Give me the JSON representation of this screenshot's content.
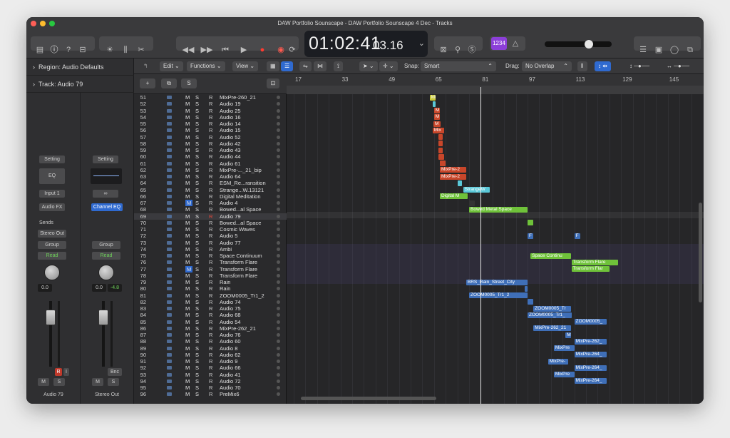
{
  "window": {
    "title": "DAW Portfolio Sounscape - DAW Portfolio Sounscape 4 Dec - Tracks"
  },
  "transport": {
    "time_main": "01:02:41",
    "time_sub": "03.16",
    "count_in": "1234"
  },
  "inspector": {
    "region_label": "Region: Audio Defaults",
    "track_label": "Track: Audio 79",
    "strip1": {
      "setting": "Setting",
      "eq": "EQ",
      "input": "Input 1",
      "fx": "Audio FX",
      "sends": "Sends",
      "output": "Stereo Out",
      "group": "Group",
      "mode": "Read",
      "pan": "0.0",
      "m": "M",
      "s": "S",
      "name": "Audio 79"
    },
    "strip2": {
      "setting": "Setting",
      "link": "∞",
      "eq": "Channel EQ",
      "group": "Group",
      "mode": "Read",
      "pan": "0.0",
      "gain": "-4.8",
      "bnc": "Bnc",
      "m": "M",
      "s": "S",
      "name": "Stereo Out"
    }
  },
  "editbar": {
    "edit": "Edit",
    "functions": "Functions",
    "view": "View",
    "snap_label": "Snap:",
    "snap_value": "Smart",
    "drag_label": "Drag:",
    "drag_value": "No Overlap"
  },
  "ruler": [
    "17",
    "33",
    "49",
    "65",
    "81",
    "97",
    "113",
    "129",
    "145"
  ],
  "tracks": [
    {
      "n": "51",
      "name": "MixPre-260_21"
    },
    {
      "n": "52",
      "name": "Audio 19"
    },
    {
      "n": "53",
      "name": "Audio 25"
    },
    {
      "n": "54",
      "name": "Audio 16"
    },
    {
      "n": "55",
      "name": "Audio 14"
    },
    {
      "n": "56",
      "name": "Audio 15"
    },
    {
      "n": "57",
      "name": "Audio 52"
    },
    {
      "n": "58",
      "name": "Audio 42"
    },
    {
      "n": "59",
      "name": "Audio 43"
    },
    {
      "n": "60",
      "name": "Audio 44"
    },
    {
      "n": "61",
      "name": "Audio 61"
    },
    {
      "n": "62",
      "name": "MixPre-..._21_bip"
    },
    {
      "n": "63",
      "name": "Audio 64"
    },
    {
      "n": "64",
      "name": "ESM_Re...ransition"
    },
    {
      "n": "65",
      "name": "Strange...W.13121"
    },
    {
      "n": "66",
      "name": "Digital Meditation"
    },
    {
      "n": "67",
      "name": "Audio 4"
    },
    {
      "n": "68",
      "name": "Bowed...al Space"
    },
    {
      "n": "69",
      "name": "Audio 79"
    },
    {
      "n": "70",
      "name": "Bowed...al Space"
    },
    {
      "n": "71",
      "name": "Cosmic Waves"
    },
    {
      "n": "72",
      "name": "Audio 5"
    },
    {
      "n": "73",
      "name": "Audio 77"
    },
    {
      "n": "74",
      "name": "Ambi"
    },
    {
      "n": "75",
      "name": "Space Continuum"
    },
    {
      "n": "76",
      "name": "Transform Flare"
    },
    {
      "n": "77",
      "name": "Transform Flare"
    },
    {
      "n": "78",
      "name": "Transform Flare"
    },
    {
      "n": "79",
      "name": "Rain"
    },
    {
      "n": "80",
      "name": "Rain"
    },
    {
      "n": "81",
      "name": "ZOOM0005_Tr1_2"
    },
    {
      "n": "82",
      "name": "Audio 74"
    },
    {
      "n": "83",
      "name": "Audio 75"
    },
    {
      "n": "84",
      "name": "Audio 68"
    },
    {
      "n": "85",
      "name": "Audio 54"
    },
    {
      "n": "86",
      "name": "MixPre-262_21"
    },
    {
      "n": "87",
      "name": "Audio 76"
    },
    {
      "n": "88",
      "name": "Audio 60"
    },
    {
      "n": "89",
      "name": "Audio 8"
    },
    {
      "n": "90",
      "name": "Audio 62"
    },
    {
      "n": "91",
      "name": "Audio 9"
    },
    {
      "n": "92",
      "name": "Audio 66"
    },
    {
      "n": "93",
      "name": "Audio 41"
    },
    {
      "n": "94",
      "name": "Audio 72"
    },
    {
      "n": "95",
      "name": "Audio 70"
    },
    {
      "n": "96",
      "name": "PreMix6"
    }
  ],
  "track_buttons": {
    "m": "M",
    "s": "S",
    "r": "R"
  },
  "regions": [
    {
      "row": 0,
      "bar": 63.5,
      "len": 2,
      "label": "Mi",
      "color": "#c9c93a"
    },
    {
      "row": 1,
      "bar": 64.5,
      "len": 1,
      "label": "",
      "color": "#5ac8d8"
    },
    {
      "row": 2,
      "bar": 65,
      "len": 2,
      "label": "M",
      "color": "#c8462a"
    },
    {
      "row": 3,
      "bar": 65,
      "len": 2,
      "label": "M",
      "color": "#c8462a"
    },
    {
      "row": 4,
      "bar": 64.8,
      "len": 2.5,
      "label": "M",
      "color": "#c8462a"
    },
    {
      "row": 5,
      "bar": 64.5,
      "len": 4,
      "label": "Mix",
      "color": "#c8462a"
    },
    {
      "row": 6,
      "bar": 66.5,
      "len": 1.5,
      "label": "",
      "color": "#c8462a"
    },
    {
      "row": 7,
      "bar": 66.5,
      "len": 1.5,
      "label": "",
      "color": "#c8462a"
    },
    {
      "row": 8,
      "bar": 66.5,
      "len": 1.5,
      "label": "",
      "color": "#c8462a"
    },
    {
      "row": 9,
      "bar": 66.5,
      "len": 2,
      "label": "",
      "color": "#c8462a"
    },
    {
      "row": 10,
      "bar": 67,
      "len": 2,
      "label": "",
      "color": "#c8462a"
    },
    {
      "row": 11,
      "bar": 67,
      "len": 9,
      "label": "MixPre-2",
      "color": "#c8462a"
    },
    {
      "row": 12,
      "bar": 67,
      "len": 9,
      "label": "MixPre-2",
      "color": "#c8462a"
    },
    {
      "row": 13,
      "bar": 73,
      "len": 1.5,
      "label": "",
      "color": "#5ac8d8"
    },
    {
      "row": 14,
      "bar": 75,
      "len": 9,
      "label": "StrangeW",
      "color": "#5ac8d8"
    },
    {
      "row": 15,
      "bar": 67,
      "len": 9.5,
      "label": "Digital M",
      "color": "#6fc23a"
    },
    {
      "row": 16,
      "bar": 77,
      "len": 2,
      "label": "",
      "color": "#333"
    },
    {
      "row": 17,
      "bar": 77,
      "len": 20,
      "label": "Bowed Metal Space",
      "color": "#6fc23a"
    },
    {
      "row": 19,
      "bar": 97,
      "len": 2,
      "label": "",
      "color": "#6fc23a"
    },
    {
      "row": 21,
      "bar": 97,
      "len": 2,
      "label": "F",
      "color": "#3f6fb8"
    },
    {
      "row": 21,
      "bar": 113,
      "len": 2,
      "label": "F",
      "color": "#3f6fb8"
    },
    {
      "row": 24,
      "bar": 98,
      "len": 14,
      "label": "Space Continu",
      "color": "#6fc23a"
    },
    {
      "row": 25,
      "bar": 112,
      "len": 16,
      "label": "Transform Flare",
      "color": "#6fc23a"
    },
    {
      "row": 26,
      "bar": 112,
      "len": 13,
      "label": "Transform Flar",
      "color": "#6fc23a"
    },
    {
      "row": 28,
      "bar": 76,
      "len": 21,
      "label": "BRS_Rain_Street_City",
      "color": "#3f6fb8"
    },
    {
      "row": 29,
      "bar": 96,
      "len": 1,
      "label": "",
      "color": "#3f6fb8"
    },
    {
      "row": 30,
      "bar": 77,
      "len": 20,
      "label": "ZOOM0005_Tr1_2",
      "color": "#3f6fb8"
    },
    {
      "row": 31,
      "bar": 97,
      "len": 2,
      "label": "",
      "color": "#3f6fb8"
    },
    {
      "row": 32,
      "bar": 99,
      "len": 13,
      "label": "ZOOM0005_Tr",
      "color": "#3f6fb8"
    },
    {
      "row": 33,
      "bar": 97,
      "len": 15,
      "label": "ZOOM0005_Tr1_",
      "color": "#3f6fb8"
    },
    {
      "row": 34,
      "bar": 113,
      "len": 11,
      "label": "ZOOM0005_",
      "color": "#3f6fb8"
    },
    {
      "row": 35,
      "bar": 99,
      "len": 13,
      "label": "MixPre-262_21",
      "color": "#3f6fb8"
    },
    {
      "row": 36,
      "bar": 110,
      "len": 2,
      "label": "M",
      "color": "#3f6fb8"
    },
    {
      "row": 37,
      "bar": 113,
      "len": 11,
      "label": "MixPre-262_",
      "color": "#3f6fb8"
    },
    {
      "row": 38,
      "bar": 106,
      "len": 7,
      "label": "MixPre",
      "color": "#3f6fb8"
    },
    {
      "row": 39,
      "bar": 113,
      "len": 11,
      "label": "MixPre-264_",
      "color": "#3f6fb8"
    },
    {
      "row": 40,
      "bar": 104,
      "len": 7,
      "label": "MixPre-",
      "color": "#3f6fb8"
    },
    {
      "row": 41,
      "bar": 113,
      "len": 11,
      "label": "MixPre-264_",
      "color": "#3f6fb8"
    },
    {
      "row": 42,
      "bar": 106,
      "len": 7,
      "label": "MixPre",
      "color": "#3f6fb8"
    },
    {
      "row": 43,
      "bar": 113,
      "len": 11,
      "label": "MixPre-264_",
      "color": "#3f6fb8"
    }
  ],
  "playhead_bar": 81
}
